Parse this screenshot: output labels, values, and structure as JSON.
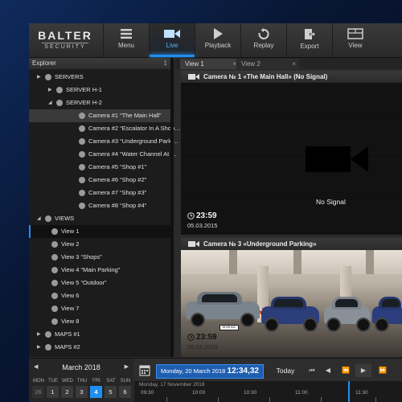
{
  "logo": {
    "line1": "BALTER",
    "line2": "SECURITY"
  },
  "toolbar": [
    {
      "label": "Menu",
      "icon": "menu-icon"
    },
    {
      "label": "Live",
      "icon": "camera-icon",
      "active": true
    },
    {
      "label": "Playback",
      "icon": "play-icon"
    },
    {
      "label": "Replay",
      "icon": "replay-icon"
    },
    {
      "label": "Export",
      "icon": "export-icon"
    },
    {
      "label": "View",
      "icon": "view-layout-icon"
    }
  ],
  "explorer": {
    "title": "Explorer",
    "pin": "‡",
    "items": [
      {
        "label": "SERVERS",
        "arrow": "▶"
      },
      {
        "label": "SERVER H-1",
        "arrow": "▶"
      },
      {
        "label": "SERVER H-2",
        "arrow": "◢"
      },
      {
        "label": "Camera #1 “The Main Hall”",
        "selected": true
      },
      {
        "label": "Camera #2 “Escalator In A Shop…"
      },
      {
        "label": "Camera #3 “Underground Parki…"
      },
      {
        "label": "Camera #4 “Water Channel At …"
      },
      {
        "label": "Camera #5 “Shop #1”"
      },
      {
        "label": "Camera #6 “Shop #2”"
      },
      {
        "label": "Camera #7 “Shop #3”"
      },
      {
        "label": "Camera #8 “Shop #4”"
      },
      {
        "label": "VIEWS",
        "arrow": "◢"
      },
      {
        "label": "View 1",
        "highlighted": true
      },
      {
        "label": "View 2"
      },
      {
        "label": "View 3 “Shops”"
      },
      {
        "label": "View 4 “Main Parking”"
      },
      {
        "label": "View 5 “Outdoor”"
      },
      {
        "label": "View 6"
      },
      {
        "label": "View 7"
      },
      {
        "label": "View 8"
      },
      {
        "label": "MAPS #1",
        "arrow": "▶"
      },
      {
        "label": "MAPS #2",
        "arrow": "▶"
      }
    ]
  },
  "tabs": [
    {
      "label": "View 1",
      "close": "×"
    },
    {
      "label": "View 2",
      "close": "×"
    }
  ],
  "panels": [
    {
      "title": "Camera № 1 «The Main Hall» (No Signal)",
      "status": "No Signal",
      "time": "23:59",
      "date": "05.03.2015"
    },
    {
      "title": "Camera № 3 «Underground Parking»",
      "plate": "M·HH 641",
      "time": "23:59",
      "date": "05.03.2015"
    }
  ],
  "calendar": {
    "month": "March 2018",
    "prev": "◀",
    "next": "▶",
    "weekdays": [
      "MON",
      "TUE",
      "WED",
      "THU",
      "FRI",
      "SAT",
      "SUN"
    ],
    "days": [
      "26",
      "1",
      "2",
      "3",
      "4",
      "5",
      "6"
    ],
    "today": "4"
  },
  "timeline": {
    "date_label": "Monday, 20 March 2018",
    "time": "12:34,32",
    "today_button": "Today",
    "controls": [
      "⏮",
      "◀",
      "⏪",
      "▶",
      "⏩"
    ],
    "ruler_date": "Monday, 17 November 2018",
    "ticks": [
      "09:30",
      "10:00",
      "10:30",
      "11:00",
      "11:30"
    ]
  },
  "colors": {
    "accent": "#1f8ef1",
    "background": "#2b2b2b"
  }
}
